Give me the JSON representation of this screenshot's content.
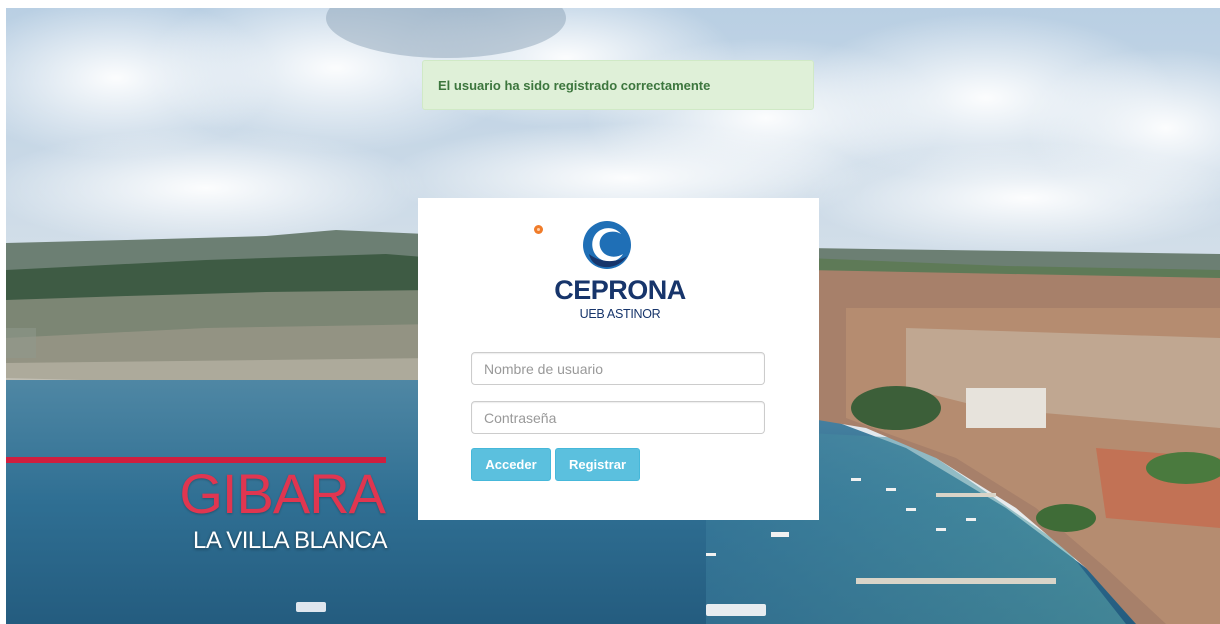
{
  "alert": {
    "message": "El usuario ha sido registrado correctamente"
  },
  "brand": {
    "name": "CEPRONA",
    "subtitle": "UEB ASTINOR"
  },
  "login": {
    "username_placeholder": "Nombre de usuario",
    "password_placeholder": "Contraseña",
    "login_label": "Acceder",
    "register_label": "Registrar"
  },
  "background": {
    "title": "GIBARA",
    "subtitle": "LA VILLA BLANCA"
  },
  "colors": {
    "alert_bg": "#dff0d8",
    "alert_text": "#3c763d",
    "button_info": "#5bc0de",
    "brand_navy": "#17356b",
    "gibara_red": "#e03650"
  },
  "icons": {
    "logo": "ceprona-logo-icon",
    "status_dot": "status-dot-icon"
  }
}
